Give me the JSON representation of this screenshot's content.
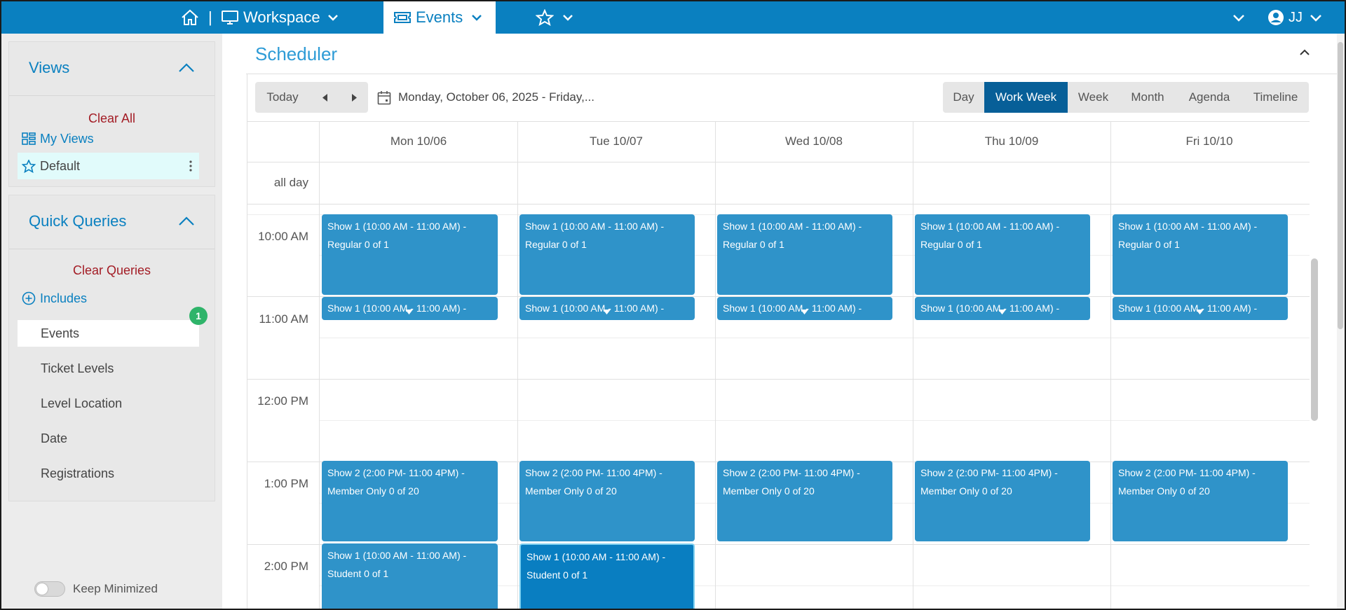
{
  "topbar": {
    "workspace_label": "Workspace",
    "separator": "|",
    "events_tab_label": "Events",
    "user_initials": "JJ",
    "colors": {
      "bar": "#0a80c0",
      "active_tab_bg": "#ffffff"
    },
    "icons": [
      "home-icon",
      "monitor-icon",
      "ticket-icon",
      "star-icon",
      "chevron-down-icon",
      "user-circle-icon"
    ]
  },
  "sidebar": {
    "views": {
      "title": "Views",
      "clear_all": "Clear All",
      "my_views": "My Views",
      "default": "Default"
    },
    "quick_queries": {
      "title": "Quick Queries",
      "clear_queries": "Clear Queries",
      "includes": "Includes",
      "items": [
        "Events",
        "Ticket Levels",
        "Level Location",
        "Date",
        "Registrations"
      ],
      "events_badge": "1"
    },
    "keep_minimized": "Keep Minimized"
  },
  "scheduler": {
    "title": "Scheduler",
    "today": "Today",
    "date_range": "Monday, October 06, 2025 - Friday,...",
    "views": [
      "Day",
      "Work Week",
      "Week",
      "Month",
      "Agenda",
      "Timeline"
    ],
    "active_view": "Work Week",
    "days": [
      "Mon 10/06",
      "Tue 10/07",
      "Wed 10/08",
      "Thu 10/09",
      "Fri 10/10"
    ],
    "all_day": "all day",
    "times": [
      "10:00 AM",
      "11:00 AM",
      "12:00 PM",
      "1:00 PM",
      "2:00 PM"
    ],
    "events": {
      "show1_regular": {
        "line1": "Show 1 (10:00 AM - 11:00 AM) -",
        "line2": "Regular 0 of 1"
      },
      "show1_short": {
        "line1": "Show 1 (10:00 AM - 11:00 AM) -"
      },
      "show2": {
        "line1": "Show 2 (2:00 PM- 11:00 4PM) -",
        "line2": "Member Only 0 of 20"
      },
      "show1_student": {
        "line1": "Show 1 (10:00 AM - 11:00 AM) -",
        "line2": "Student 0 of 1"
      }
    },
    "colors": {
      "event": "#2f93c9",
      "event_selected": "#097ec1",
      "active_view_bg": "#075f98",
      "title": "#2d9bd6"
    }
  }
}
